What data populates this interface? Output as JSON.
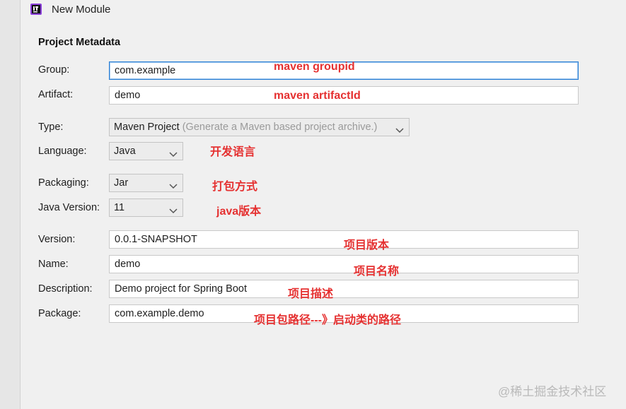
{
  "window": {
    "title": "New Module",
    "icon": "intellij-icon"
  },
  "section_title": "Project Metadata",
  "fields": {
    "group": {
      "label": "Group:",
      "value": "com.example"
    },
    "artifact": {
      "label": "Artifact:",
      "value": "demo"
    },
    "type": {
      "label": "Type:",
      "value": "Maven Project",
      "hint": "(Generate a Maven based project archive.)"
    },
    "language": {
      "label": "Language:",
      "value": "Java"
    },
    "packaging": {
      "label": "Packaging:",
      "value": "Jar"
    },
    "java_version": {
      "label": "Java Version:",
      "value": "11"
    },
    "version": {
      "label": "Version:",
      "value": "0.0.1-SNAPSHOT"
    },
    "name": {
      "label": "Name:",
      "value": "demo"
    },
    "description": {
      "label": "Description:",
      "value": "Demo project for Spring Boot"
    },
    "package": {
      "label": "Package:",
      "value": "com.example.demo"
    }
  },
  "annotations": {
    "group": "maven groupid",
    "artifact": "maven artifactId",
    "language": "开发语言",
    "packaging": "打包方式",
    "java_version": "java版本",
    "version": "项目版本",
    "name": "项目名称",
    "description": "项目描述",
    "package": "项目包路径---》启动类的路径"
  },
  "watermark": "@稀土掘金技术社区",
  "colors": {
    "annotation": "#e53131",
    "focus_border": "#2a7fd4",
    "background": "#f0f0f0"
  }
}
